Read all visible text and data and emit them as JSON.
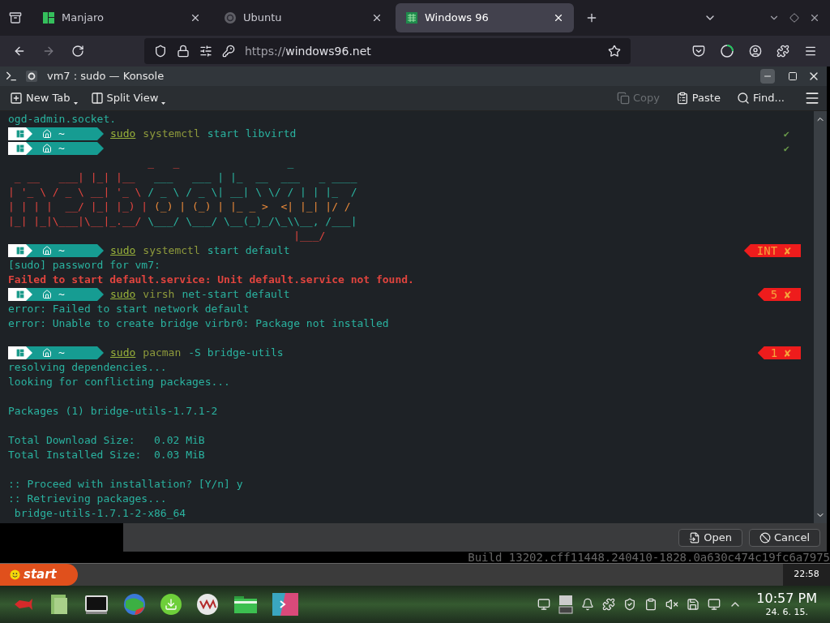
{
  "browser": {
    "tabs": [
      {
        "label": "Manjaro",
        "selected": false
      },
      {
        "label": "Ubuntu",
        "selected": false
      },
      {
        "label": "Windows 96",
        "selected": true
      }
    ],
    "url_scheme": "https://",
    "url_host": "windows96.net"
  },
  "konsole": {
    "title": "vm7 : sudo — Konsole",
    "toolbar_left": [
      {
        "label": "New Tab",
        "disabled": false
      },
      {
        "label": "Split View",
        "disabled": false
      }
    ],
    "toolbar_right": [
      {
        "label": "Copy",
        "disabled": true
      },
      {
        "label": "Paste",
        "disabled": false
      },
      {
        "label": "Find...",
        "disabled": false
      }
    ],
    "lines": [
      {
        "kind": "output",
        "text": "ogd-admin.socket."
      },
      {
        "kind": "prompt",
        "dir": "~",
        "sudo": "sudo",
        "cmd": "systemctl",
        "args": "start libvirtd",
        "status": {
          "kind": "ok",
          "text": "✔"
        }
      },
      {
        "kind": "prompt",
        "dir": "~",
        "status": {
          "kind": "ok",
          "text": "✔"
        }
      },
      {
        "kind": "art",
        "segments": [
          "                      _   _",
          "                 _"
        ]
      },
      {
        "kind": "art",
        "segments": [
          " _ __   ___| |_| |__",
          "   ___   ___ | |_  __  ___   _ ____"
        ]
      },
      {
        "kind": "art",
        "segments": [
          "| '_ \\ / _ \\ __| '_ \\",
          " / _ \\ / _ \\| __| \\ \\/ / | | |_  /"
        ]
      },
      {
        "kind": "art",
        "segments": [
          "| | | |  __/ |_| |_) |",
          " (_) | (_) | |_ _ >  <| |_| |/ /"
        ]
      },
      {
        "kind": "art",
        "segments": [
          "|_| |_|\\___|\\__|_.__/",
          " \\___/ \\___/ \\__(_)_/\\_\\\\__, /___|"
        ]
      },
      {
        "kind": "art",
        "segments": [
          "                                             |___/"
        ]
      },
      {
        "kind": "prompt",
        "dir": "~",
        "sudo": "sudo",
        "cmd": "systemctl",
        "args": "start default",
        "status": {
          "kind": "error",
          "text": "INT ✘"
        }
      },
      {
        "kind": "output",
        "text": "[sudo] password for vm7:"
      },
      {
        "kind": "error",
        "text": "Failed to start default.service: Unit default.service not found."
      },
      {
        "kind": "prompt",
        "dir": "~",
        "sudo": "sudo",
        "cmd": "virsh",
        "args": "net-start default",
        "status": {
          "kind": "error",
          "text": "5 ✘"
        }
      },
      {
        "kind": "output",
        "text": "error: Failed to start network default"
      },
      {
        "kind": "output",
        "text": "error: Unable to create bridge virbr0: Package not installed"
      },
      {
        "kind": "blank"
      },
      {
        "kind": "prompt",
        "dir": "~",
        "sudo": "sudo",
        "cmd": "pacman",
        "args": "-S bridge-utils",
        "status": {
          "kind": "error",
          "text": "1 ✘"
        }
      },
      {
        "kind": "output",
        "text": "resolving dependencies..."
      },
      {
        "kind": "output",
        "text": "looking for conflicting packages..."
      },
      {
        "kind": "blank"
      },
      {
        "kind": "output",
        "text": "Packages (1) bridge-utils-1.7.1-2"
      },
      {
        "kind": "blank"
      },
      {
        "kind": "output",
        "text": "Total Download Size:   0.02 MiB"
      },
      {
        "kind": "output",
        "text": "Total Installed Size:  0.03 MiB"
      },
      {
        "kind": "blank"
      },
      {
        "kind": "output",
        "text": ":: Proceed with installation? [Y/n] y"
      },
      {
        "kind": "output",
        "text": ":: Retrieving packages..."
      },
      {
        "kind": "output",
        "text": " bridge-utils-1.7.1-2-x86_64"
      }
    ]
  },
  "dialog": {
    "buttons": [
      "Open",
      "Cancel"
    ]
  },
  "build": "Build 13202.cff11448.240410-1828.0a630c474c19fc6a7975",
  "win96": {
    "start": "start",
    "clock": "22:58"
  },
  "panel": {
    "time": "10:57 PM",
    "date": "24. 6. 15."
  }
}
